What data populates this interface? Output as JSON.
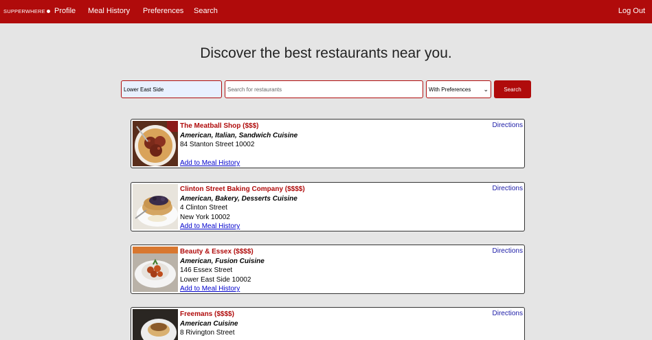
{
  "nav": {
    "brand": "SUPPERWHERE",
    "links": [
      "Profile",
      "Meal History",
      "Preferences",
      "Search"
    ],
    "logout": "Log Out"
  },
  "headline": "Discover the best restaurants near you.",
  "search": {
    "location_value": "Lower East Side",
    "query_placeholder": "Search for restaurants",
    "preference_selected": "With Preferences",
    "button_label": "Search"
  },
  "restaurants": [
    {
      "name": "The Meatball Shop ($$$)",
      "cuisine": "American, Italian, Sandwich Cuisine",
      "address1": "84 Stanton Street 10002",
      "address2": "",
      "add_label": "Add to Meal History",
      "directions": "Directions"
    },
    {
      "name": "Clinton Street Baking Company ($$$$)",
      "cuisine": "American, Bakery, Desserts Cuisine",
      "address1": "4 Clinton Street",
      "address2": "New York 10002",
      "add_label": "Add to Meal History",
      "directions": "Directions"
    },
    {
      "name": "Beauty & Essex ($$$$)",
      "cuisine": "American, Fusion Cuisine",
      "address1": "146 Essex Street",
      "address2": "Lower East Side 10002",
      "add_label": "Add to Meal History",
      "directions": "Directions"
    },
    {
      "name": "Freemans ($$$$)",
      "cuisine": "American Cuisine",
      "address1": "8 Rivington Street",
      "address2": "",
      "add_label": "",
      "directions": "Directions"
    }
  ]
}
